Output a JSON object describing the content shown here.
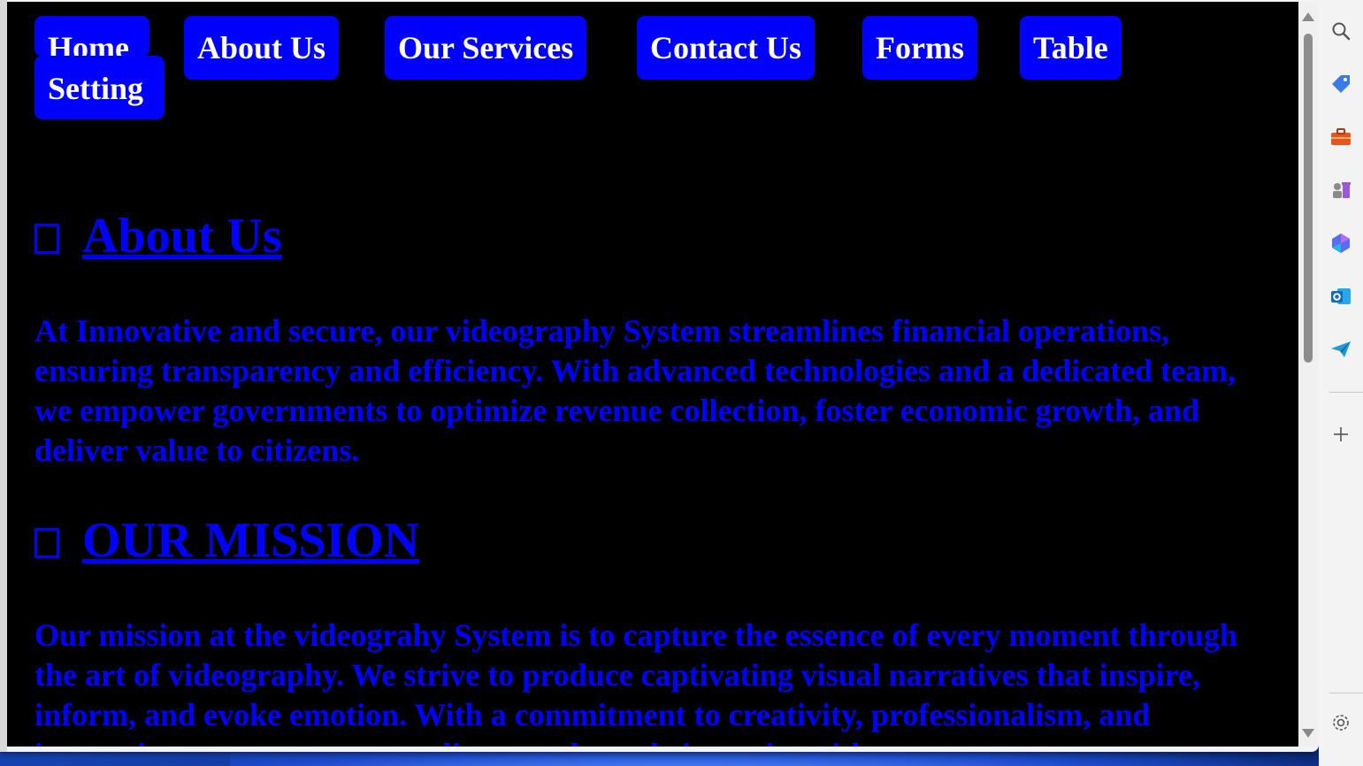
{
  "nav": {
    "items": [
      {
        "label": "Home"
      },
      {
        "label": "About Us"
      },
      {
        "label": "Our Services"
      },
      {
        "label": "Contact Us"
      },
      {
        "label": "Forms"
      },
      {
        "label": "Table"
      },
      {
        "label": "Setting"
      }
    ]
  },
  "sections": [
    {
      "title": "About Us",
      "text": "At Innovative and secure, our videography System streamlines financial operations, ensuring transparency and efficiency. With advanced technologies and a dedicated team, we empower governments to optimize revenue collection, foster economic growth, and deliver value to citizens."
    },
    {
      "title": "OUR MISSION",
      "text": "Our mission at the videograhy System is to capture the essence of every moment through the art of videography. We strive to produce captivating visual narratives that inspire, inform, and evoke emotion. With a commitment to creativity, professionalism, and innovation, we empower our clients to share their stories with"
    }
  ],
  "colors": {
    "accent": "#0000ff",
    "page_background": "#000000",
    "nav_text": "#ffffff"
  },
  "sidebar_icons": [
    "search-icon",
    "tag-icon",
    "toolbox-icon",
    "chess-icon",
    "copilot-icon",
    "outlook-icon",
    "send-icon",
    "add-icon",
    "settings-icon"
  ]
}
